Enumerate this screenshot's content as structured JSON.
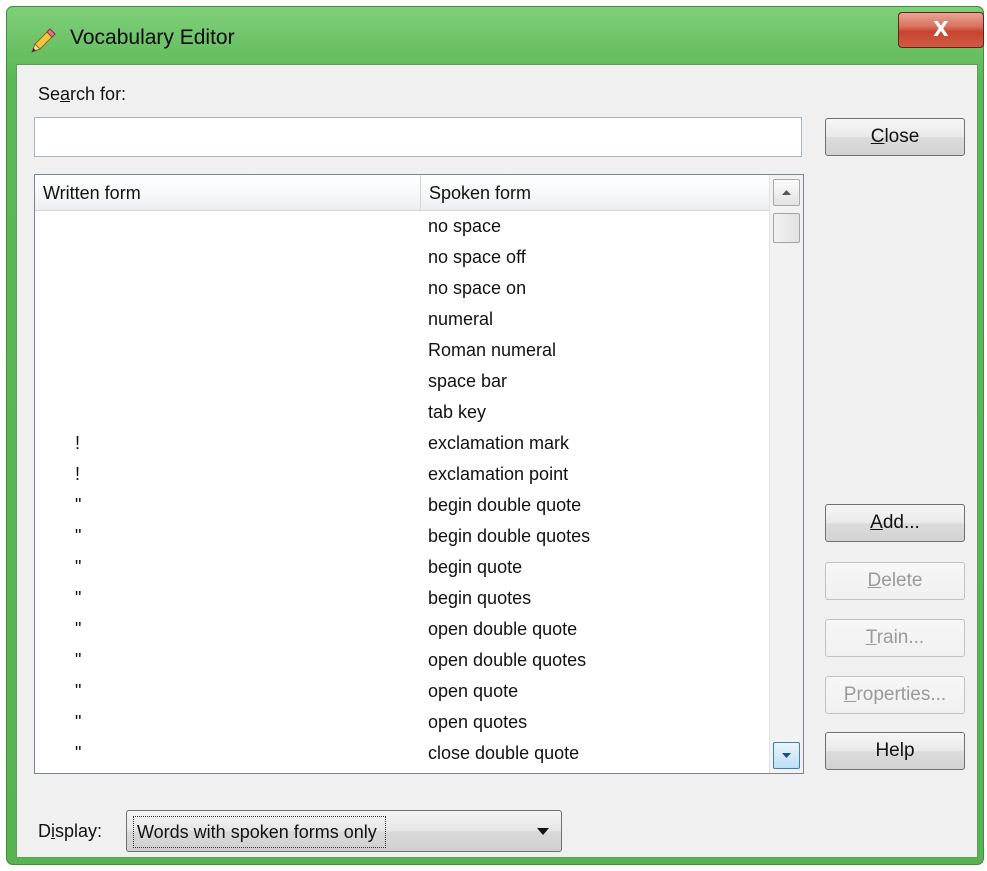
{
  "window": {
    "title": "Vocabulary Editor",
    "close_glyph": "X"
  },
  "icons": {
    "app": "pencil-icon",
    "close": "close-icon"
  },
  "search": {
    "label": "Search for:",
    "value": "",
    "placeholder": ""
  },
  "buttons": {
    "close": "Close",
    "add": "Add...",
    "delete": "Delete",
    "train": "Train...",
    "properties": "Properties...",
    "help": "Help"
  },
  "list": {
    "columns": [
      "Written form",
      "Spoken form"
    ],
    "rows": [
      {
        "written": "",
        "spoken": "no space"
      },
      {
        "written": "",
        "spoken": "no space off"
      },
      {
        "written": "",
        "spoken": "no space on"
      },
      {
        "written": "",
        "spoken": "numeral"
      },
      {
        "written": "",
        "spoken": "Roman numeral"
      },
      {
        "written": "",
        "spoken": "space bar"
      },
      {
        "written": "",
        "spoken": "tab key"
      },
      {
        "written": "!",
        "spoken": "exclamation mark"
      },
      {
        "written": "!",
        "spoken": "exclamation point"
      },
      {
        "written": "\"",
        "spoken": "begin double quote"
      },
      {
        "written": "\"",
        "spoken": "begin double quotes"
      },
      {
        "written": "\"",
        "spoken": "begin quote"
      },
      {
        "written": "\"",
        "spoken": "begin quotes"
      },
      {
        "written": "\"",
        "spoken": "open double quote"
      },
      {
        "written": "\"",
        "spoken": "open double quotes"
      },
      {
        "written": "\"",
        "spoken": "open quote"
      },
      {
        "written": "\"",
        "spoken": "open quotes"
      },
      {
        "written": "\"",
        "spoken": "close double quote"
      }
    ]
  },
  "display": {
    "label": "Display:",
    "selected": "Words with spoken forms only"
  },
  "colors": {
    "title_bar": "#6cc267",
    "close_button": "#c7452f",
    "dialog_bg": "#f0f0f0"
  }
}
